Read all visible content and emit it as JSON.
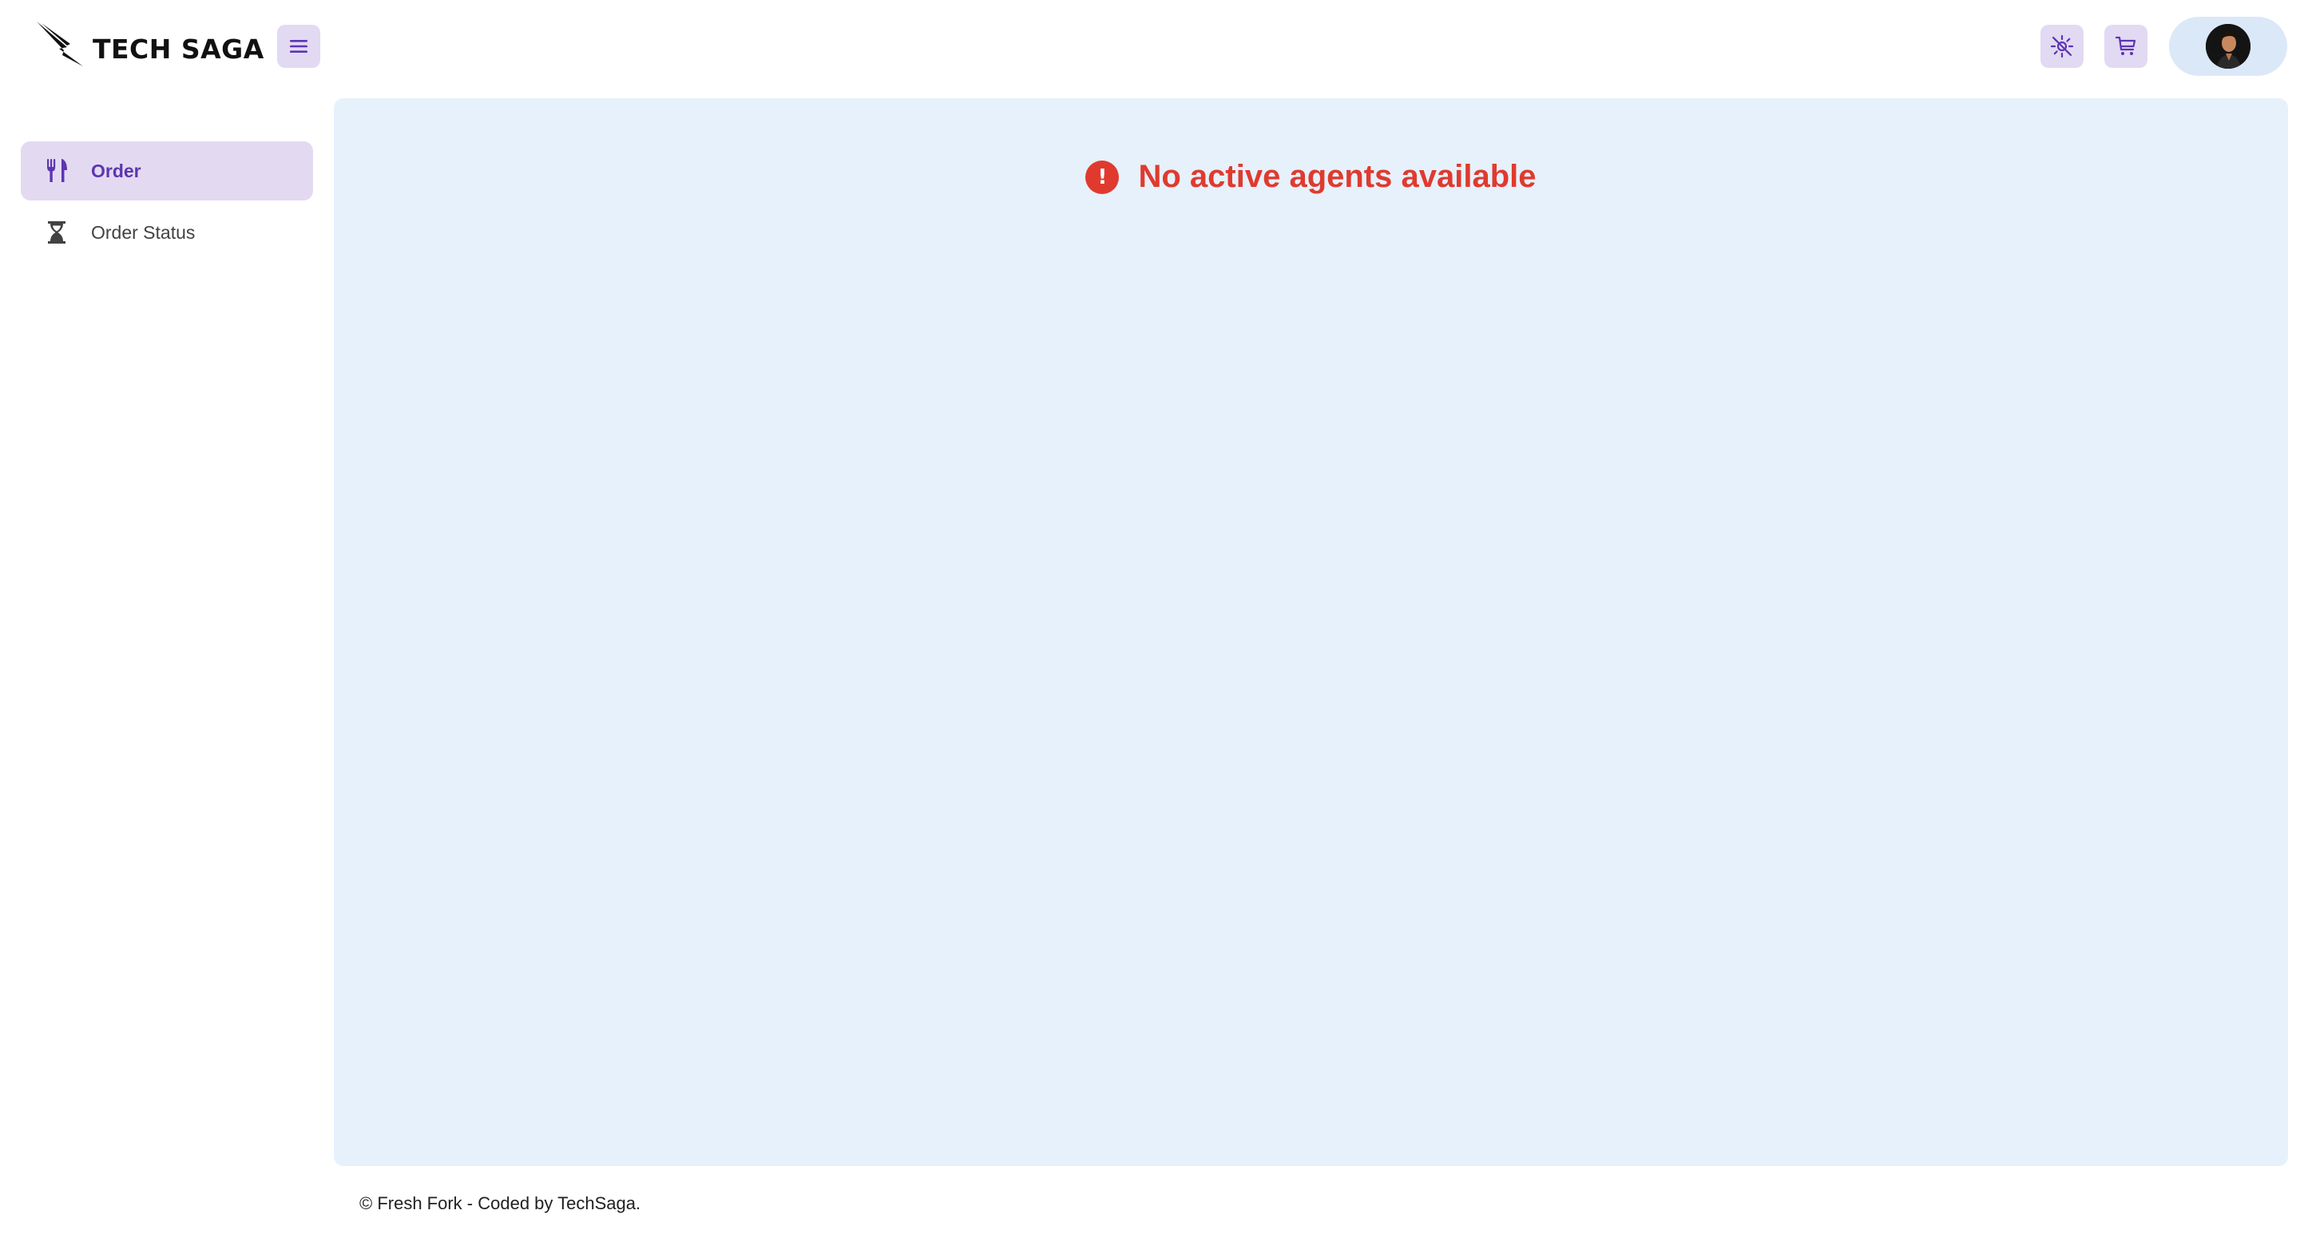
{
  "header": {
    "logo_text": "TECH SAGA",
    "menu_icon": "hamburger-menu-icon",
    "theme_icon": "sun-theme-icon",
    "cart_icon": "shopping-cart-icon",
    "profile_icon": "user-avatar"
  },
  "sidebar": {
    "items": [
      {
        "label": "Order",
        "icon": "fork-knife-icon",
        "active": true
      },
      {
        "label": "Order Status",
        "icon": "hourglass-icon",
        "active": false
      }
    ]
  },
  "main": {
    "alert_icon": "error-icon",
    "alert_text": "No active agents available"
  },
  "footer": {
    "text": "© Fresh Fork - Coded by TechSaga."
  },
  "colors": {
    "accent": "#5e35b1",
    "accent_bg": "#e3daf2",
    "content_bg": "#e6f1fb",
    "error": "#e03a2f"
  }
}
